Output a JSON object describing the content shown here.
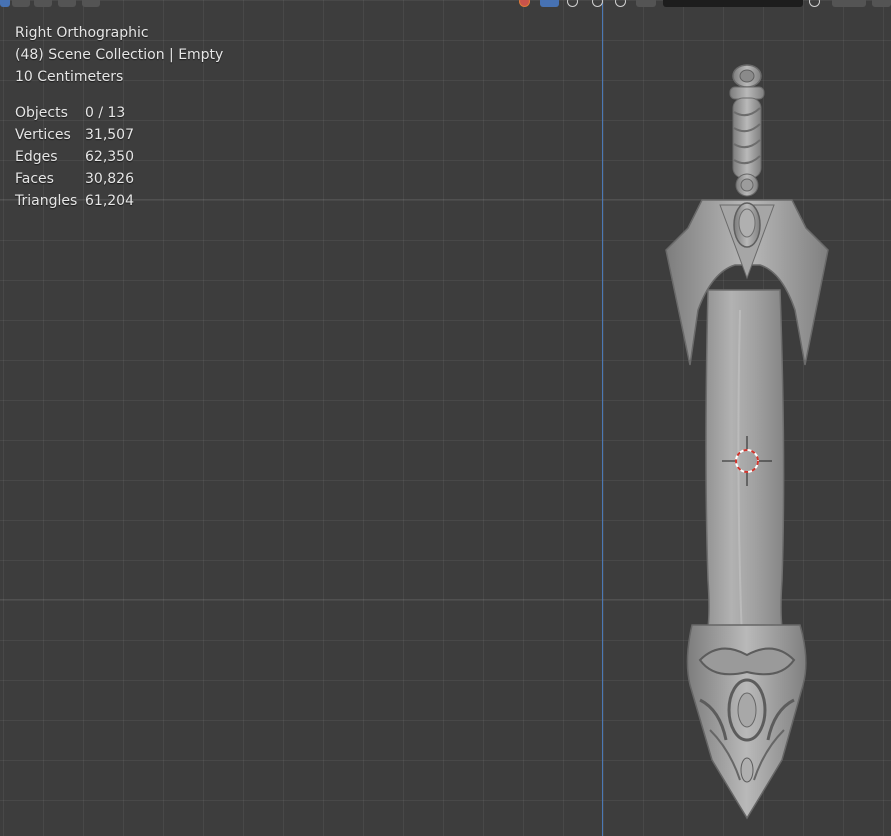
{
  "viewport": {
    "view_name": "Right Orthographic",
    "collection_info": "(48) Scene Collection | Empty",
    "grid_scale": "10 Centimeters",
    "stats": [
      {
        "label": "Objects",
        "value": "0 / 13"
      },
      {
        "label": "Vertices",
        "value": "31,507"
      },
      {
        "label": "Edges",
        "value": "62,350"
      },
      {
        "label": "Faces",
        "value": "30,826"
      },
      {
        "label": "Triangles",
        "value": "61,204"
      }
    ]
  },
  "icons": {
    "cursor": "3d-cursor-icon",
    "axis": "vertical-axis-line"
  },
  "colors": {
    "background": "#3d3d3d",
    "axis_blue": "#4a78b5",
    "model_gray": "#9a9a9a",
    "text": "#e6e6e6",
    "cursor_red": "#d0342c"
  }
}
